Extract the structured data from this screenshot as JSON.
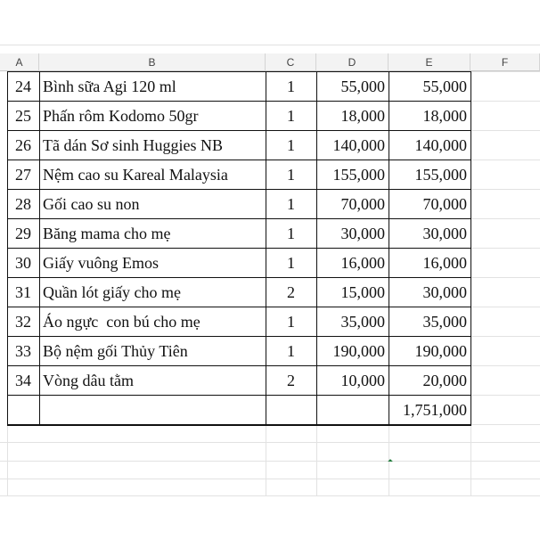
{
  "columns": [
    "A",
    "B",
    "C",
    "D",
    "E",
    "F"
  ],
  "rows": [
    {
      "no": "24",
      "item": "Bình sữa Agi 120 ml",
      "qty": "1",
      "price": "55,000",
      "total": "55,000"
    },
    {
      "no": "25",
      "item": "Phấn rôm Kodomo 50gr",
      "qty": "1",
      "price": "18,000",
      "total": "18,000"
    },
    {
      "no": "26",
      "item": "Tã dán Sơ sinh Huggies NB",
      "qty": "1",
      "price": "140,000",
      "total": "140,000"
    },
    {
      "no": "27",
      "item": "Nệm cao su Kareal Malaysia",
      "qty": "1",
      "price": "155,000",
      "total": "155,000"
    },
    {
      "no": "28",
      "item": "Gối cao su non",
      "qty": "1",
      "price": "70,000",
      "total": "70,000"
    },
    {
      "no": "29",
      "item": "Băng mama cho mẹ",
      "qty": "1",
      "price": "30,000",
      "total": "30,000"
    },
    {
      "no": "30",
      "item": "Giấy vuông Emos",
      "qty": "1",
      "price": "16,000",
      "total": "16,000"
    },
    {
      "no": "31",
      "item": "Quần lót giấy cho mẹ",
      "qty": "2",
      "price": "15,000",
      "total": "30,000"
    },
    {
      "no": "32",
      "item": "Áo ngực  con bú cho mẹ",
      "qty": "1",
      "price": "35,000",
      "total": "35,000"
    },
    {
      "no": "33",
      "item": "Bộ nệm gối Thủy Tiên",
      "qty": "1",
      "price": "190,000",
      "total": "190,000"
    },
    {
      "no": "34",
      "item": "Vòng dâu tằm",
      "qty": "2",
      "price": "10,000",
      "total": "20,000"
    }
  ],
  "grand_total": "1,751,000",
  "colors": {
    "header_bg": "#f3f3f3",
    "gridline": "#e2e2e2",
    "border": "#111111",
    "selection_marker": "#1f7a3a"
  }
}
